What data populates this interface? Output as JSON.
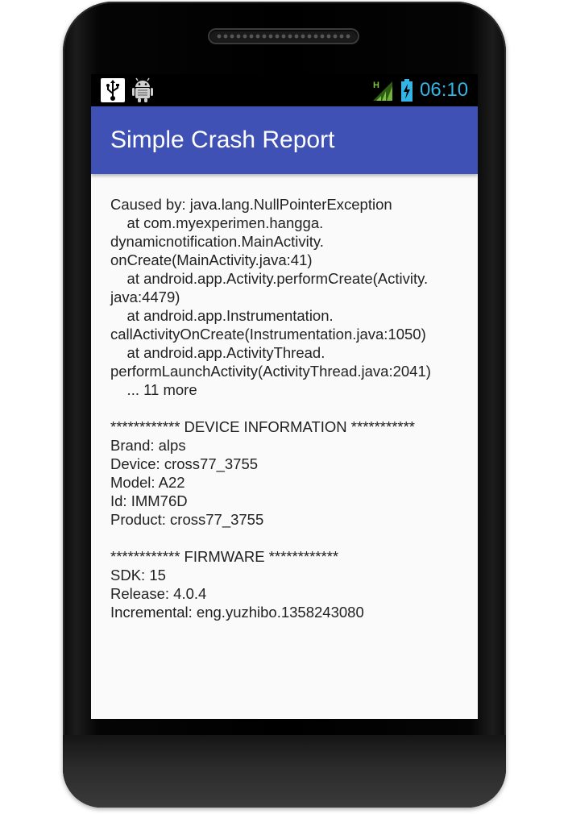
{
  "status_bar": {
    "time": "06:10",
    "network_type": "H",
    "icons": [
      "usb-debugging-icon",
      "android-debug-icon",
      "signal-icon",
      "battery-charging-icon"
    ],
    "clock_color": "#33b5e5"
  },
  "app_bar": {
    "title": "Simple Crash Report",
    "color": "#3f51b5"
  },
  "report": {
    "lines": [
      "Caused by: java.lang.NullPointerException",
      "    at com.myexperimen.hangga.",
      "dynamicnotification.MainActivity.",
      "onCreate(MainActivity.java:41)",
      "    at android.app.Activity.performCreate(Activity.",
      "java:4479)",
      "    at android.app.Instrumentation.",
      "callActivityOnCreate(Instrumentation.java:1050)",
      "    at android.app.ActivityThread.",
      "performLaunchActivity(ActivityThread.java:2041)",
      "    ... 11 more",
      "",
      "************ DEVICE INFORMATION ***********",
      "Brand: alps",
      "Device: cross77_3755",
      "Model: A22",
      "Id: IMM76D",
      "Product: cross77_3755",
      "",
      "************ FIRMWARE ************",
      "SDK: 15",
      "Release: 4.0.4",
      "Incremental: eng.yuzhibo.1358243080"
    ]
  }
}
